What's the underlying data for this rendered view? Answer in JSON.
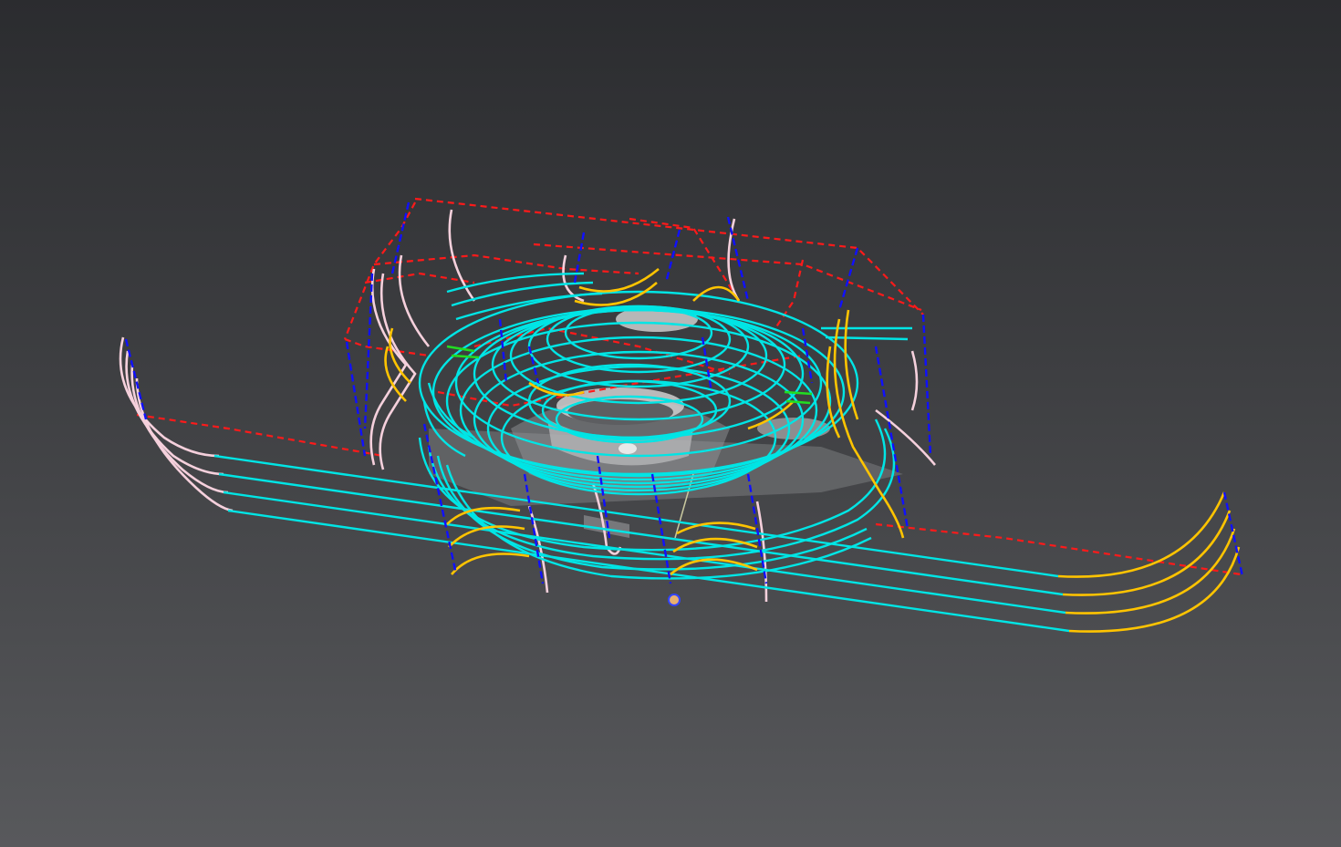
{
  "viewport": {
    "background_top": "#2b2c2f",
    "background_bottom": "#58595c"
  },
  "toolpath_colors": {
    "cutting": "#00e5e5",
    "lead_in_out": "#ffc400",
    "link": "#f5d0dc",
    "rapid": "#ff1a1a",
    "plunge": "#1010ff",
    "step": "#22dd22",
    "part": "#c8c8c8"
  },
  "icons": {
    "tool_tip": "tool-tip-marker-icon"
  }
}
